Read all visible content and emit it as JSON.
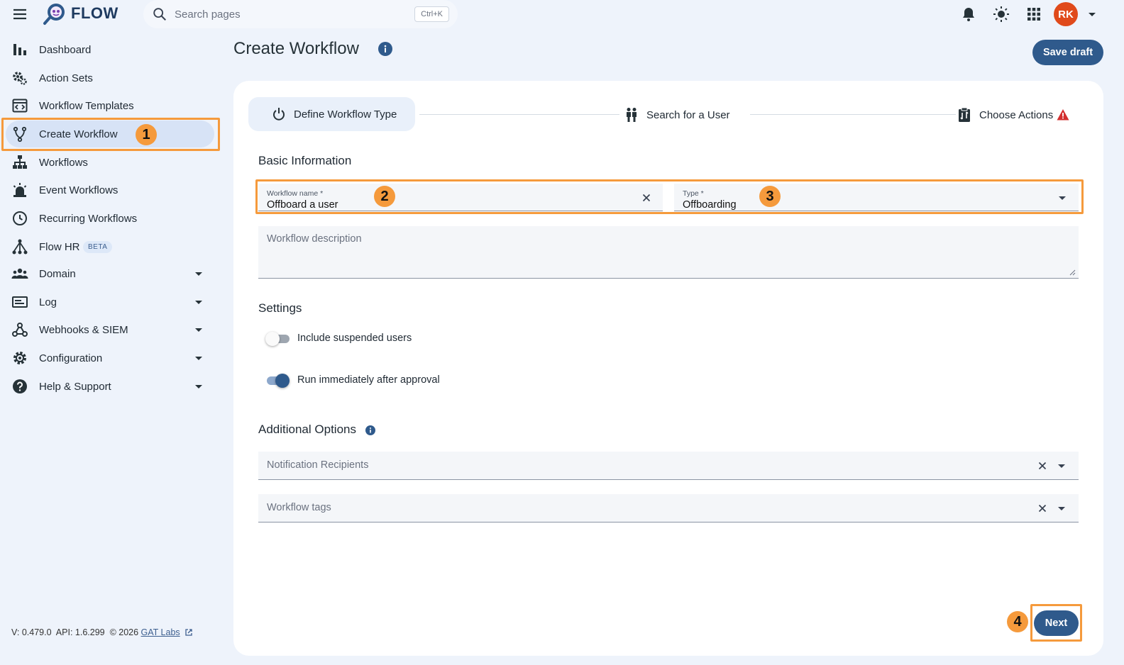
{
  "app": {
    "name": "FLOW"
  },
  "search": {
    "placeholder": "Search pages",
    "shortcut": "Ctrl+K"
  },
  "user": {
    "initials": "RK"
  },
  "sidebar": {
    "items": [
      {
        "label": "Dashboard",
        "icon": "bar-chart-icon"
      },
      {
        "label": "Action Sets",
        "icon": "gears-icon"
      },
      {
        "label": "Workflow Templates",
        "icon": "template-icon"
      },
      {
        "label": "Create Workflow",
        "icon": "fork-icon",
        "active": true
      },
      {
        "label": "Workflows",
        "icon": "hierarchy-icon"
      },
      {
        "label": "Event Workflows",
        "icon": "alarm-icon"
      },
      {
        "label": "Recurring Workflows",
        "icon": "clock-icon"
      },
      {
        "label": "Flow HR",
        "icon": "network-icon",
        "badge": "BETA"
      },
      {
        "label": "Domain",
        "icon": "people-icon",
        "expandable": true
      },
      {
        "label": "Log",
        "icon": "log-icon",
        "expandable": true
      },
      {
        "label": "Webhooks & SIEM",
        "icon": "webhook-icon",
        "expandable": true
      },
      {
        "label": "Configuration",
        "icon": "gear-icon",
        "expandable": true
      },
      {
        "label": "Help & Support",
        "icon": "help-icon",
        "expandable": true
      }
    ],
    "footer": {
      "version": "V: 0.479.0",
      "api": "API: 1.6.299",
      "copyright": "© 2026",
      "company": "GAT Labs"
    }
  },
  "page": {
    "title": "Create Workflow",
    "save_draft": "Save draft"
  },
  "stepper": {
    "steps": [
      {
        "label": "Define Workflow Type",
        "active": true
      },
      {
        "label": "Search for a User"
      },
      {
        "label": "Choose Actions",
        "warning": true
      }
    ]
  },
  "basic_info": {
    "heading": "Basic Information",
    "name_label": "Workflow name *",
    "name_value": "Offboard a user",
    "type_label": "Type *",
    "type_value": "Offboarding",
    "description_placeholder": "Workflow description"
  },
  "settings": {
    "heading": "Settings",
    "include_suspended": {
      "label": "Include suspended users",
      "on": false
    },
    "run_immediately": {
      "label": "Run immediately after approval",
      "on": true
    }
  },
  "additional": {
    "heading": "Additional Options",
    "notification_placeholder": "Notification Recipients",
    "tags_placeholder": "Workflow tags"
  },
  "actions": {
    "next": "Next"
  },
  "annotations": [
    "1",
    "2",
    "3",
    "4"
  ],
  "colors": {
    "accent": "#2f5a8c",
    "highlight": "#f59a3c",
    "avatar": "#e04a1b",
    "warning": "#d32f2f"
  }
}
